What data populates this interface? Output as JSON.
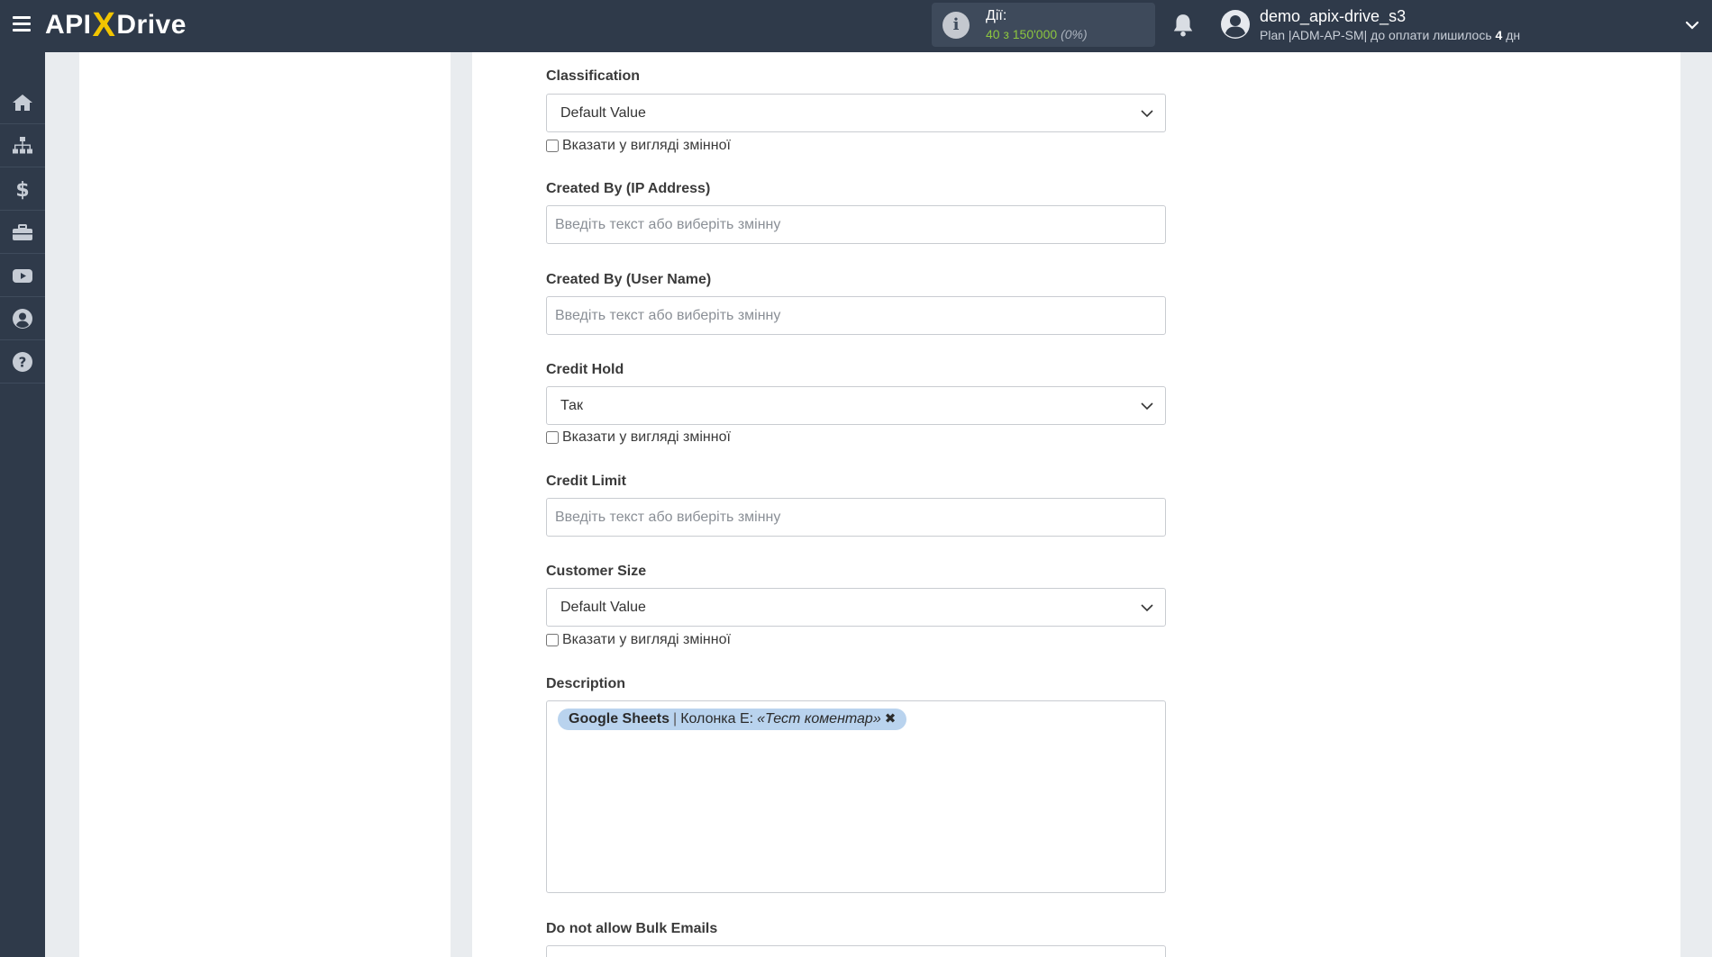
{
  "app": {
    "logo_left": "API",
    "logo_x": "X",
    "logo_right": "Drive"
  },
  "header": {
    "actions_label": "Дії:",
    "actions_count": "40 з 150'000",
    "actions_percent": "(0%)",
    "user_name": "demo_apix-drive_s3",
    "plan_prefix": "Plan |ADM-AP-SM| до оплати лишилось ",
    "plan_days": "4",
    "plan_suffix": " дн"
  },
  "sidebar": {
    "items": [
      {
        "icon": "home-icon"
      },
      {
        "icon": "sitemap-icon"
      },
      {
        "icon": "dollar-icon"
      },
      {
        "icon": "briefcase-icon"
      },
      {
        "icon": "video-icon"
      },
      {
        "icon": "user-circle-icon"
      },
      {
        "icon": "help-icon"
      }
    ]
  },
  "form": {
    "classification": {
      "label": "Classification",
      "value": "Default Value",
      "checkbox_label": "Вказати у вигляді змінної"
    },
    "created_by_ip": {
      "label": "Created By (IP Address)",
      "placeholder": "Введіть текст або виберіть змінну"
    },
    "created_by_user": {
      "label": "Created By (User Name)",
      "placeholder": "Введіть текст або виберіть змінну"
    },
    "credit_hold": {
      "label": "Credit Hold",
      "value": "Так",
      "checkbox_label": "Вказати у вигляді змінної"
    },
    "credit_limit": {
      "label": "Credit Limit",
      "placeholder": "Введіть текст або виберіть змінну"
    },
    "customer_size": {
      "label": "Customer Size",
      "value": "Default Value",
      "checkbox_label": "Вказати у вигляді змінної"
    },
    "description": {
      "label": "Description",
      "tag_source": "Google Sheets",
      "tag_sep": "|",
      "tag_column": "Колонка E:",
      "tag_value": "«Тест коментар»",
      "tag_remove": "✖"
    },
    "bulk_emails": {
      "label": "Do not allow Bulk Emails"
    }
  },
  "colors": {
    "topbar": "#2f3a4a",
    "accent_green": "#8cc63f",
    "logo_x": "#f2c500",
    "tag_bg": "#b9d3ee"
  }
}
